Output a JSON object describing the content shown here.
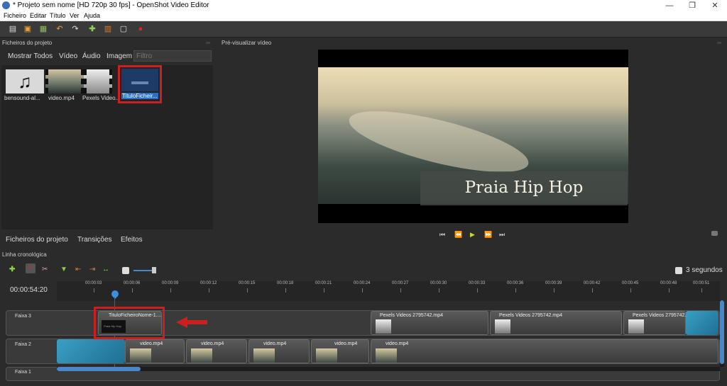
{
  "window": {
    "title": "* Projeto sem nome [HD 720p 30 fps] - OpenShot Video Editor",
    "minimize": "—",
    "maximize": "❐",
    "close": "✕"
  },
  "menu": [
    "Ficheiro",
    "Editar",
    "Título",
    "Ver",
    "Ajuda"
  ],
  "panels": {
    "files_title": "Ficheiros do projeto",
    "preview_title": "Pré-visualizar vídeo",
    "timeline_title": "Linha cronológica"
  },
  "file_filters": [
    "Mostrar Todos",
    "Vídeo",
    "Áudio",
    "Imagem"
  ],
  "filter_placeholder": "Filtro",
  "files": [
    {
      "name": "bensound-al..."
    },
    {
      "name": "video.mp4"
    },
    {
      "name": "Pexels Video..."
    },
    {
      "name": "TituloFicheir..."
    }
  ],
  "bottom_tabs": [
    "Ficheiros do projeto",
    "Transições",
    "Efeitos"
  ],
  "preview": {
    "caption": "Praia Hip Hop",
    "title_clip_text": "Praia Hip Hop"
  },
  "playback": {
    "start": "⏮",
    "rewind": "⏪",
    "play": "▶",
    "forward": "⏩",
    "end": "⏭"
  },
  "timeline": {
    "current_time": "00:00:54:20",
    "zoom_label": "3 segundos",
    "ticks": [
      "00:00:03",
      "00:00:06",
      "00:00:09",
      "00:00:12",
      "00:00:15",
      "00:00:18",
      "00:00:21",
      "00:00:24",
      "00:00:27",
      "00:00:30",
      "00:00:33",
      "00:00:36",
      "00:00:39",
      "00:00:42",
      "00:00:45",
      "00:00:48",
      "00:00:51"
    ],
    "tracks": [
      {
        "label": "Faixa 3"
      },
      {
        "label": "Faixa 2"
      },
      {
        "label": "Faixa 1"
      }
    ],
    "track3_clips": [
      "TituloFicheiroNome-1....",
      "Pexels Videos 2795742.mp4",
      "Pexels Videos 2795742.mp4",
      "Pexels Videos 2795742.m"
    ],
    "track2_clips": [
      "video.mp4",
      "video.mp4",
      "video.mp4",
      "video.mp4",
      "video.mp4",
      "video.mp4"
    ]
  },
  "colors": {
    "highlight": "#cc1f1f",
    "accent": "#9ec127",
    "selected_clip": "#3a9fc4"
  }
}
